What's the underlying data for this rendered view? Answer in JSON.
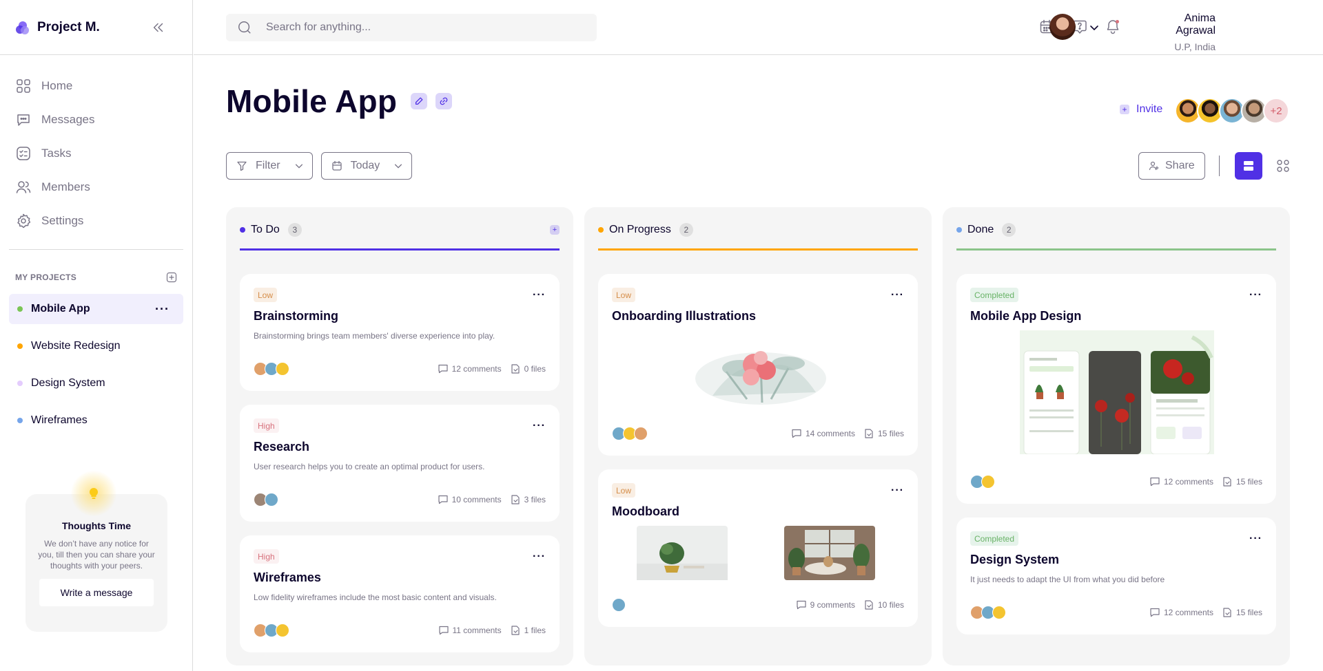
{
  "brand": {
    "name": "Project M."
  },
  "nav": [
    {
      "label": "Home",
      "icon": "grid-icon"
    },
    {
      "label": "Messages",
      "icon": "message-icon"
    },
    {
      "label": "Tasks",
      "icon": "task-icon"
    },
    {
      "label": "Members",
      "icon": "members-icon"
    },
    {
      "label": "Settings",
      "icon": "gear-icon"
    }
  ],
  "projects": {
    "heading": "MY PROJECTS",
    "items": [
      {
        "label": "Mobile App",
        "color": "#7ac555",
        "active": true
      },
      {
        "label": "Website Redesign",
        "color": "#ffa500"
      },
      {
        "label": "Design System",
        "color": "#e4ccfd"
      },
      {
        "label": "Wireframes",
        "color": "#76a5ea"
      }
    ]
  },
  "thoughts": {
    "title": "Thoughts Time",
    "text": "We don’t have any notice for you, till then you can share your thoughts with your peers.",
    "button": "Write a message"
  },
  "search": {
    "placeholder": "Search for anything..."
  },
  "user": {
    "name": "Anima Agrawal",
    "location": "U.P, India"
  },
  "page": {
    "title": "Mobile App"
  },
  "invite": {
    "label": "Invite",
    "more_count": "+2"
  },
  "toolbar": {
    "filter": "Filter",
    "date": "Today",
    "share": "Share"
  },
  "colors": {
    "accent": "#5030e5",
    "todo": "#5030e5",
    "progress": "#ffa500",
    "done": "#8bc48a"
  },
  "columns": [
    {
      "name": "To Do",
      "count": "3",
      "cards": [
        {
          "priority": "Low",
          "title": "Brainstorming",
          "desc": "Brainstorming brings team members' diverse experience into play.",
          "comments": "12 comments",
          "files": "0 files"
        },
        {
          "priority": "High",
          "title": "Research",
          "desc": "User research helps you to create an optimal product for users.",
          "comments": "10 comments",
          "files": "3 files"
        },
        {
          "priority": "High",
          "title": "Wireframes",
          "desc": "Low fidelity wireframes include the most basic content and visuals.",
          "comments": "11 comments",
          "files": "1 files"
        }
      ]
    },
    {
      "name": "On Progress",
      "count": "2",
      "cards": [
        {
          "priority": "Low",
          "title": "Onboarding Illustrations",
          "comments": "14 comments",
          "files": "15 files"
        },
        {
          "priority": "Low",
          "title": "Moodboard",
          "comments": "9 comments",
          "files": "10 files"
        }
      ]
    },
    {
      "name": "Done",
      "count": "2",
      "cards": [
        {
          "priority": "Completed",
          "title": "Mobile App Design",
          "comments": "12 comments",
          "files": "15 files"
        },
        {
          "priority": "Completed",
          "title": "Design System",
          "desc": "It just needs to adapt the UI from what you did before",
          "comments": "12 comments",
          "files": "15 files"
        }
      ]
    }
  ]
}
